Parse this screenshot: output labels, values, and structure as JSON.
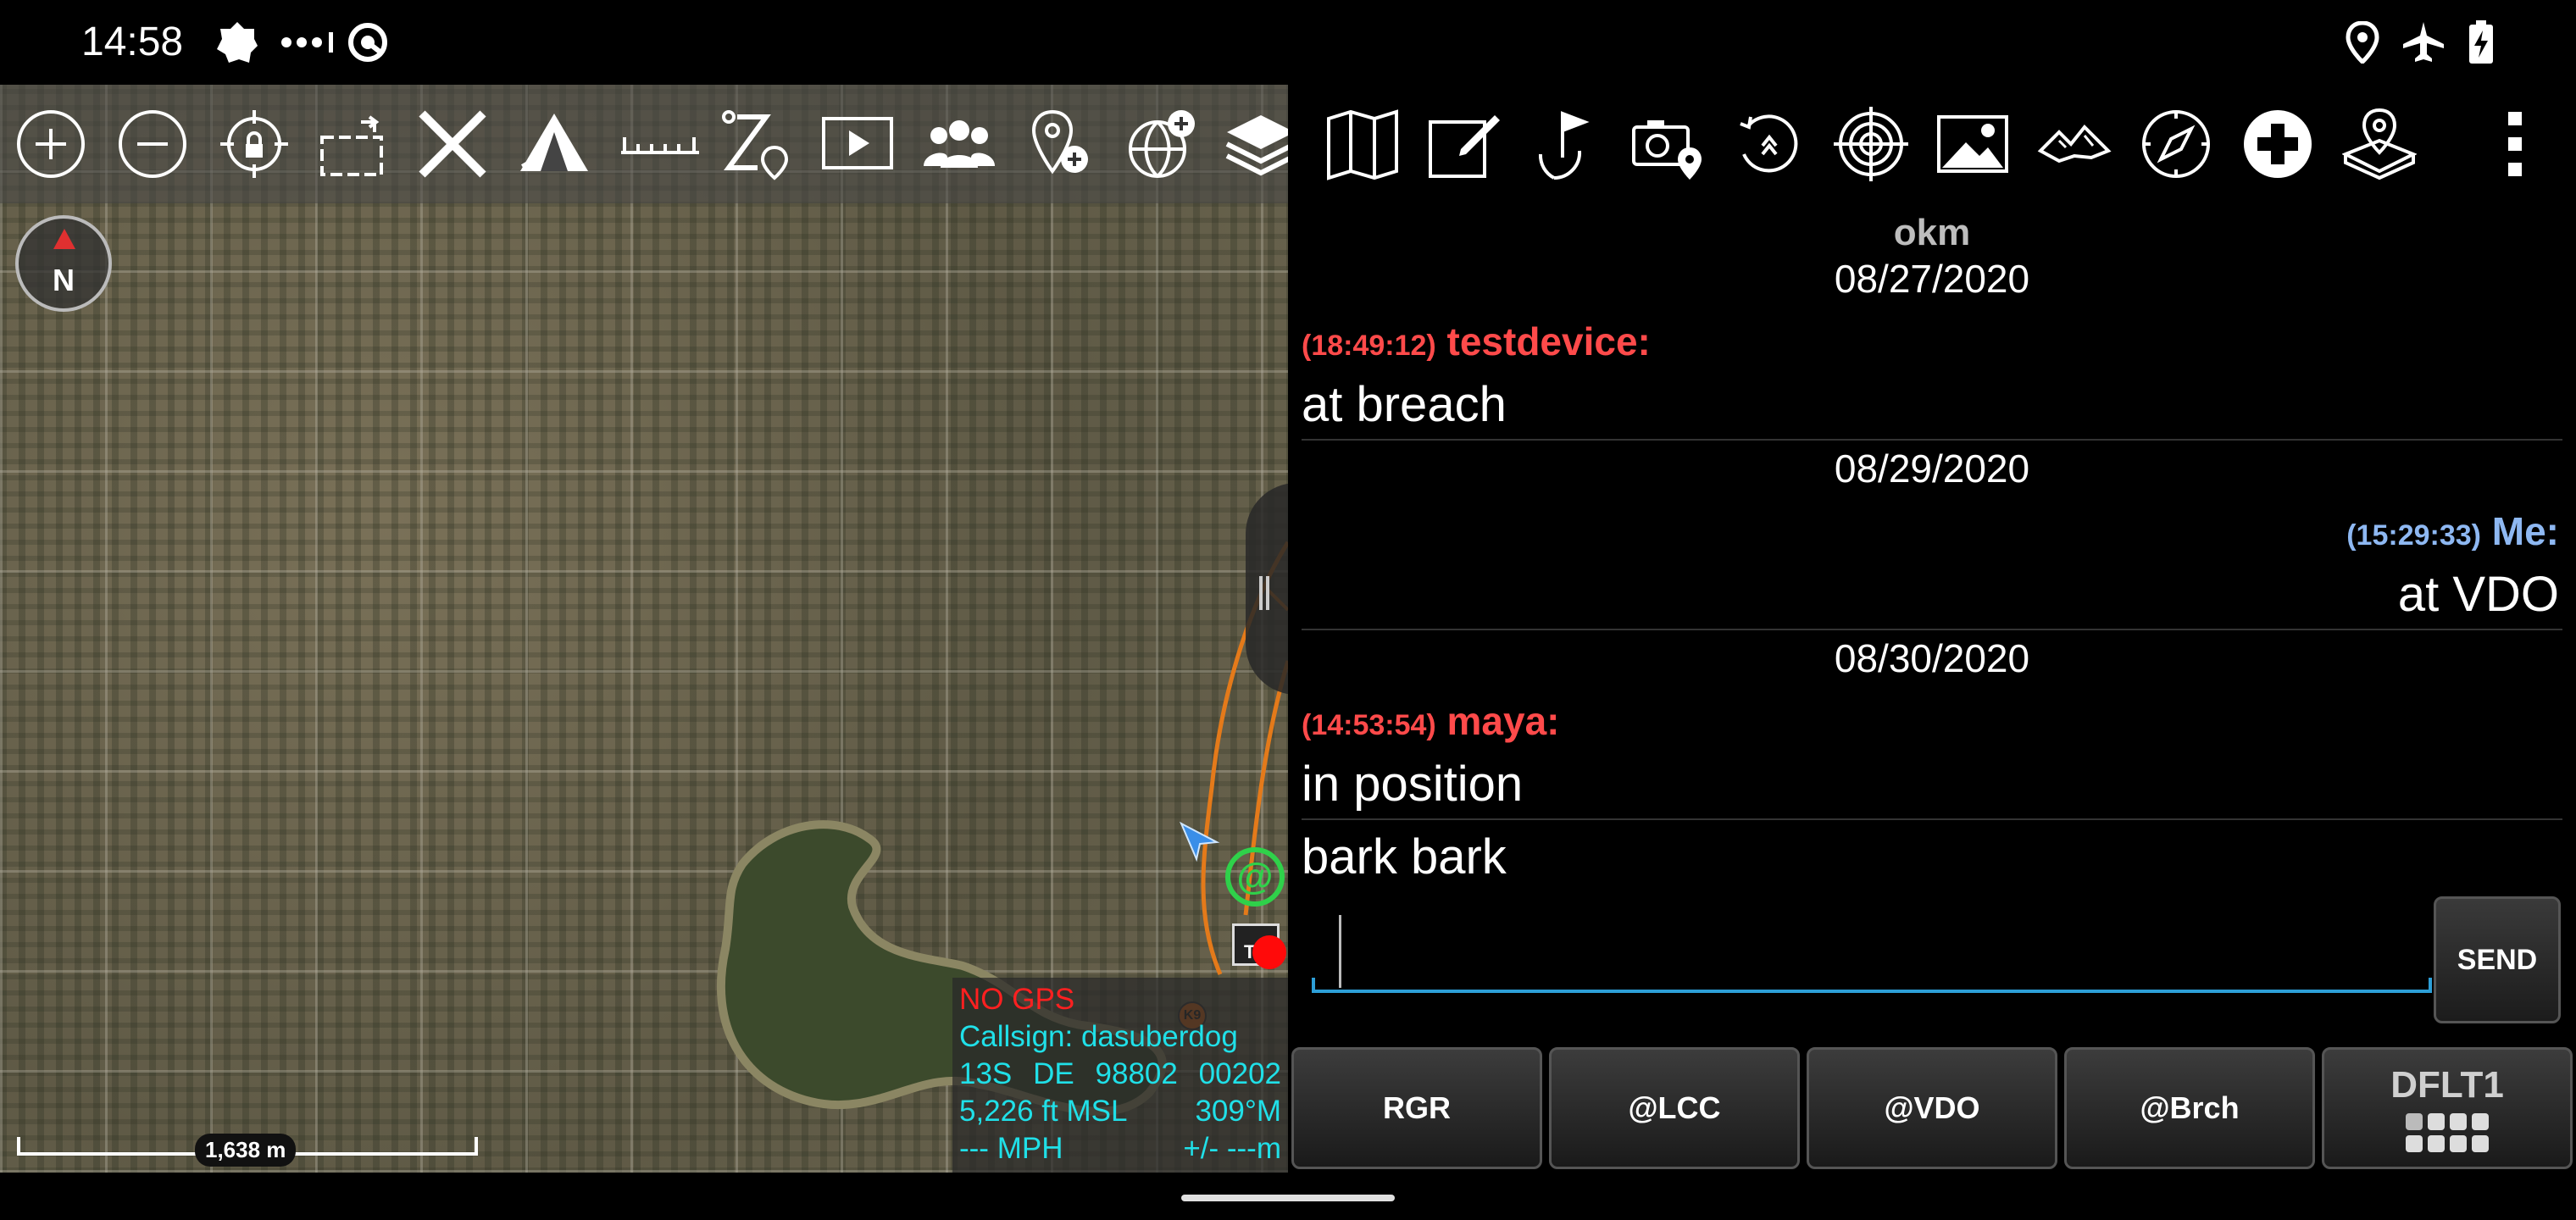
{
  "status_bar": {
    "time": "14:58",
    "left_icons": [
      "settings-gear-icon",
      "more-dots-icon",
      "sync-icon"
    ],
    "right_icons": [
      "location-icon",
      "airplane-mode-icon",
      "battery-charging-icon"
    ]
  },
  "map": {
    "toolbar_icons": [
      "zoom-in-icon",
      "zoom-out-icon",
      "lock-location-icon",
      "rotate-icon",
      "close-x-icon",
      "tent-icon",
      "ruler-icon",
      "route-icon",
      "video-player-icon",
      "contacts-icon",
      "add-point-icon",
      "add-overlay-icon"
    ],
    "compass_label": "N",
    "info": {
      "gps_status": "NO GPS",
      "callsign": "Callsign: dasuberdog",
      "grid_zone": "13S",
      "grid_square": "DE",
      "easting": "98802",
      "northing": "00202",
      "elevation": "5,226 ft MSL",
      "heading": "309°M",
      "speed": "--- MPH",
      "accuracy": "+/- ---m"
    },
    "scale_label": "1,638 m",
    "colors": {
      "info_text": "#20e0e8",
      "no_gps": "#ff2020",
      "lake": "#3c4a2c"
    }
  },
  "chat": {
    "toolbar_icons": [
      "layers-icon",
      "map-folded-icon",
      "edit-note-icon",
      "flag-nav-icon",
      "camera-location-icon",
      "history-icon",
      "crosshair-target-icon",
      "image-icon",
      "terrain-icon",
      "compass-rose-icon",
      "medical-cross-icon",
      "location-drop-icon",
      "overflow-menu-icon"
    ],
    "title": "okm",
    "dates": [
      "08/27/2020",
      "08/29/2020",
      "08/30/2020"
    ],
    "messages": [
      {
        "time": "(18:49:12)",
        "sender": "testdevice:",
        "text": "at breach"
      },
      {
        "time": "(15:29:33)",
        "sender": "Me:",
        "text": "at VDO"
      },
      {
        "time": "(14:53:54)",
        "sender": "maya:",
        "text": "in position"
      },
      {
        "text": "bark bark"
      }
    ],
    "input": {
      "value": "",
      "placeholder": ""
    },
    "send_label": "SEND",
    "quick_replies": [
      "RGR",
      "@LCC",
      "@VDO",
      "@Brch"
    ],
    "preset_label": "DFLT1",
    "colors": {
      "remote_sender": "#ff4a4a",
      "own_sender": "#8eb8f2",
      "input_underline": "#2d9fd8"
    }
  }
}
